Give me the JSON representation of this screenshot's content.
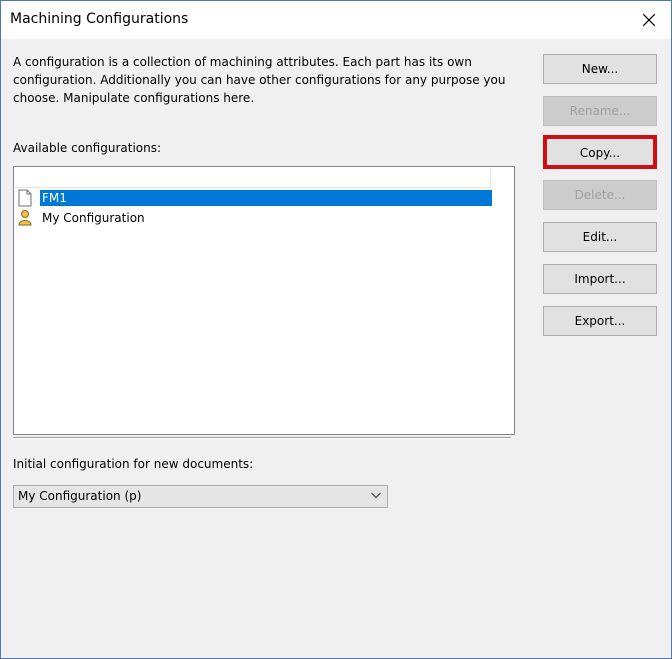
{
  "window": {
    "title": "Machining Configurations"
  },
  "description": "A configuration is a collection of machining attributes. Each part has its own configuration. Additionally you can have other configurations for any purpose you choose. Manipulate configurations here.",
  "available": {
    "label": "Available configurations:",
    "items": [
      {
        "label": "FM1",
        "icon": "document-icon",
        "selected": true
      },
      {
        "label": "My Configuration",
        "icon": "user-icon",
        "selected": false
      }
    ]
  },
  "initial": {
    "label": "Initial configuration for new documents:",
    "value": "My Configuration (p)"
  },
  "buttons": {
    "new": "New...",
    "rename": "Rename...",
    "copy": "Copy...",
    "delete": "Delete...",
    "edit": "Edit...",
    "import": "Import...",
    "export": "Export..."
  },
  "colors": {
    "selection": "#0078d7",
    "highlight": "#d01010"
  }
}
